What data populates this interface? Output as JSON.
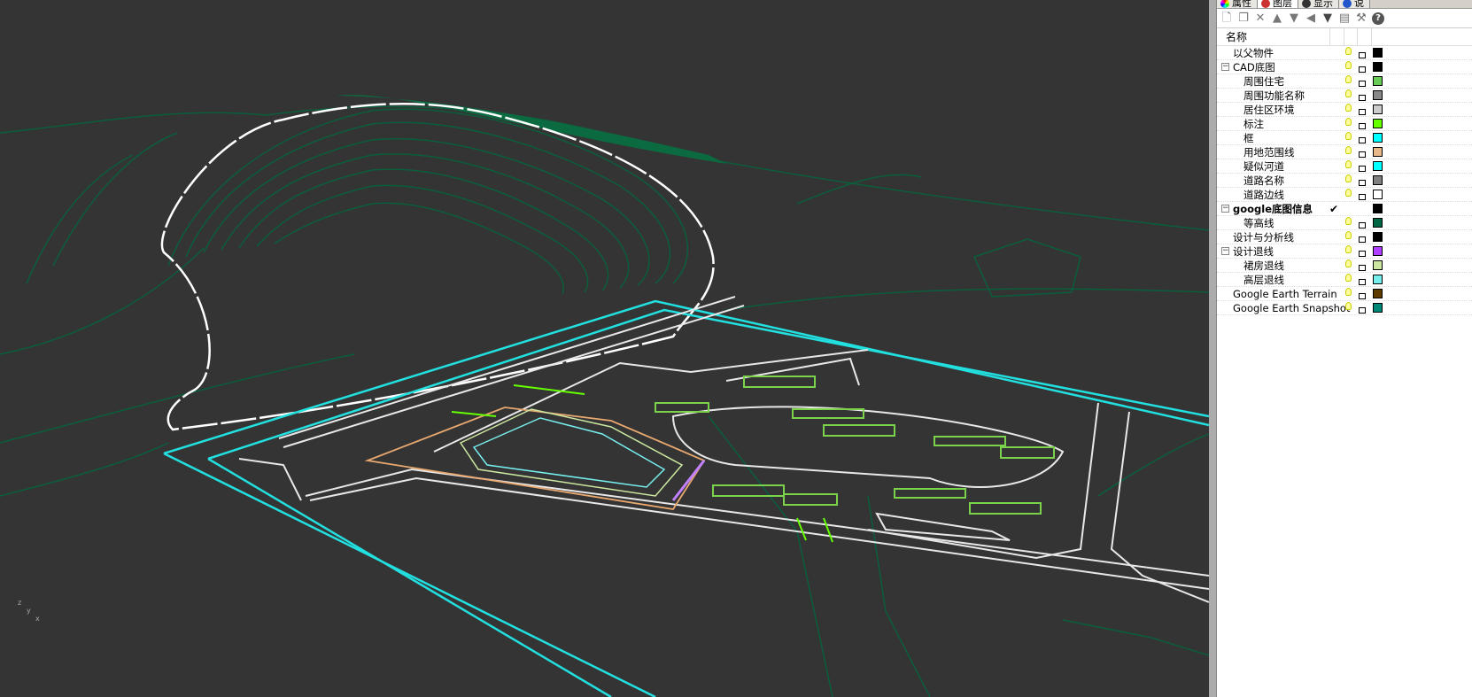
{
  "panel": {
    "tabs": [
      {
        "label": "属性",
        "icon": "properties-icon"
      },
      {
        "label": "图层",
        "icon": "layers-icon"
      },
      {
        "label": "显示",
        "icon": "display-icon"
      },
      {
        "label": "说",
        "icon": "help-icon"
      }
    ],
    "toolbar": [
      "new-layer-icon",
      "new-sublayer-icon",
      "delete-icon",
      "move-up-icon",
      "move-down-icon",
      "move-left-icon",
      "filter-icon",
      "document-icon",
      "tools-icon",
      "help-icon"
    ],
    "column_name": "名称",
    "layers": [
      {
        "name": "以父物件",
        "level": 1,
        "color": "#000000"
      },
      {
        "name": "CAD底图",
        "level": 0,
        "expander": "⊟",
        "color": "#000000"
      },
      {
        "name": "周围住宅",
        "level": 2,
        "color": "#66cc55"
      },
      {
        "name": "周围功能名称",
        "level": 2,
        "color": "#888888"
      },
      {
        "name": "居住区环境",
        "level": 2,
        "color": "#cccccc"
      },
      {
        "name": "标注",
        "level": 2,
        "color": "#66ff00"
      },
      {
        "name": "框",
        "level": 2,
        "color": "#00ffff"
      },
      {
        "name": "用地范围线",
        "level": 2,
        "color": "#e8b888"
      },
      {
        "name": "疑似河道",
        "level": 2,
        "color": "#00ffff"
      },
      {
        "name": "道路名称",
        "level": 2,
        "color": "#808080"
      },
      {
        "name": "道路边线",
        "level": 2,
        "color": "#ffffff"
      },
      {
        "name": "google底图信息",
        "level": 0,
        "expander": "⊟",
        "bold": true,
        "current": "✔",
        "color": "#000000"
      },
      {
        "name": "等高线",
        "level": 2,
        "color": "#006644"
      },
      {
        "name": "设计与分析线",
        "level": 1,
        "color": "#000000"
      },
      {
        "name": "设计退线",
        "level": 0,
        "expander": "⊟",
        "color": "#b040ff"
      },
      {
        "name": "裙房退线",
        "level": 2,
        "color": "#cce8a0"
      },
      {
        "name": "高层退线",
        "level": 2,
        "color": "#77eeee"
      },
      {
        "name": "Google Earth Terrain",
        "level": 1,
        "color": "#5c3a00"
      },
      {
        "name": "Google Earth Snapshot",
        "level": 1,
        "color": "#008877"
      }
    ]
  },
  "viewport": {
    "axis_labels": [
      "z",
      "y",
      "x"
    ],
    "colors": {
      "contour": "#0b5e3c",
      "road": "#e8e8e8",
      "boundary": "#22e0e0",
      "site": "#e8a870",
      "building": "#7ad34a",
      "setback": "#c080ff"
    }
  }
}
